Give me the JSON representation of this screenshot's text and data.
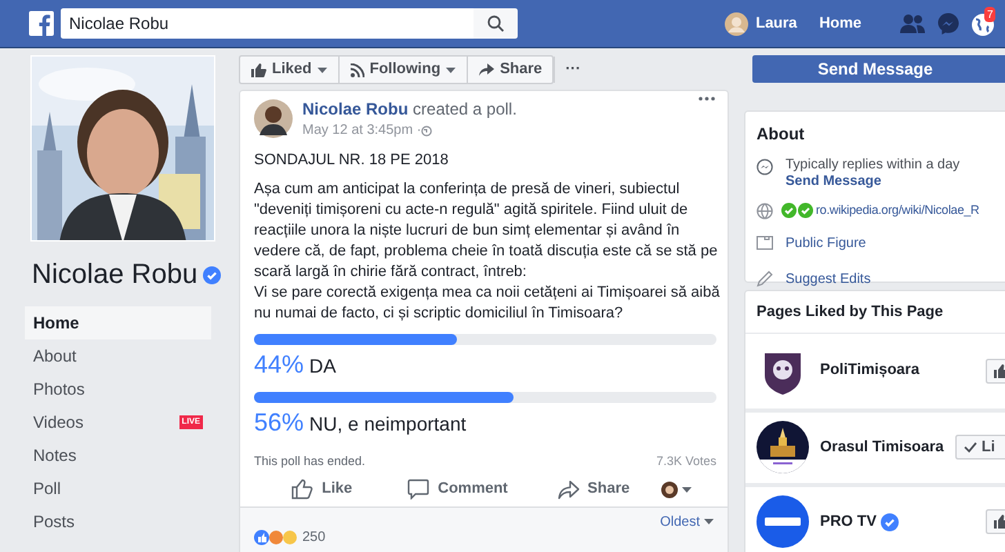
{
  "topbar": {
    "search": {
      "value": "Nicolae Robu"
    },
    "user": "Laura",
    "home": "Home",
    "notification_count": "7"
  },
  "profile": {
    "name": "Nicolae Robu",
    "verified": true,
    "nav": [
      {
        "label": "Home",
        "selected": true
      },
      {
        "label": "About",
        "selected": false
      },
      {
        "label": "Photos",
        "selected": false
      },
      {
        "label": "Videos",
        "selected": false,
        "badge": "LIVE"
      },
      {
        "label": "Notes",
        "selected": false
      },
      {
        "label": "Poll",
        "selected": false
      },
      {
        "label": "Posts",
        "selected": false
      }
    ]
  },
  "actions": [
    {
      "kind": "like",
      "label": "Liked"
    },
    {
      "kind": "follow",
      "label": "Following"
    },
    {
      "kind": "share",
      "label": "Share"
    },
    {
      "kind": "more",
      "label": "···"
    }
  ],
  "post": {
    "author": "Nicolae Robu",
    "action": "created a poll.",
    "time": "May 12 at 3:45pm · ",
    "title": "SONDAJUL NR. 18 PE 2018",
    "body": "Așa cum am anticipat la conferința de presă de vineri, subiectul \"deveniți timișoreni cu acte-n regulă\" agită spiritele. Fiind uluit de reacțiile unora la niște lucruri de bun simț elementar și având în vedere că, de fapt, problema cheie în toată discuția este că se stă pe scară largă în chirie fără contract, întreb:",
    "question": "Vi se pare corectă exigența mea ca noii cetățeni ai Timișoarei să aibă nu numai de facto, ci și scriptic domiciliul în Timisoara?",
    "options": [
      {
        "percent": "44%",
        "label": "DA",
        "level": 0.44
      },
      {
        "percent": "56%",
        "label": "NU, e neimportant",
        "level": 0.56
      }
    ],
    "ended": "This poll has ended.",
    "votes": "7.3K Votes",
    "buttons": [
      {
        "kind": "like",
        "label": "Like"
      },
      {
        "kind": "comment",
        "label": "Comment"
      },
      {
        "kind": "share",
        "label": "Share"
      }
    ],
    "reaction_count": "250",
    "sort": "Oldest"
  },
  "send_message": "Send Message",
  "about": {
    "title": "About",
    "reply_time": "Typically replies within a day",
    "reply_link": "Send Message",
    "website": "ro.wikipedia.org/wiki/Nicolae_R",
    "category": "Public Figure",
    "suggest": "Suggest Edits"
  },
  "pages_liked": {
    "title": "Pages Liked by This Page",
    "pages": [
      {
        "name": "PoliTimișoara",
        "liked": false
      },
      {
        "name": "Orasul Timisoara",
        "liked": true,
        "button": "Li"
      },
      {
        "name": "PRO TV",
        "verified": true,
        "liked": false
      }
    ]
  }
}
